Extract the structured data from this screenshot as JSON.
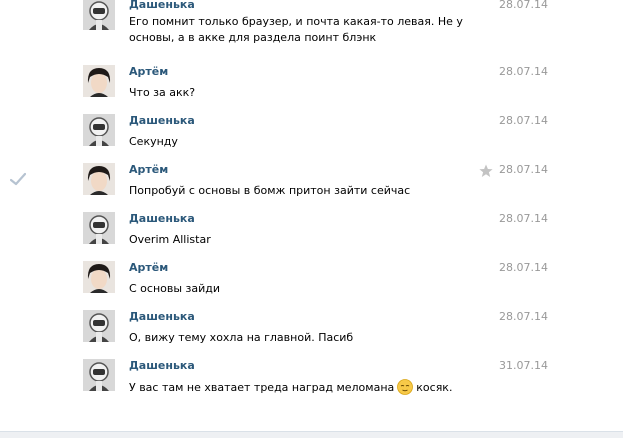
{
  "messages": [
    {
      "author": "Дашенька",
      "date": "28.07.14",
      "text": "Его помнит только браузер, и почта какая-то левая. Не у основы, а в акке для раздела поинт блэнк",
      "avatar": "helmet"
    },
    {
      "author": "Артём",
      "date": "28.07.14",
      "text": "Что за акк?",
      "avatar": "person"
    },
    {
      "author": "Дашенька",
      "date": "28.07.14",
      "text": "Секунду",
      "avatar": "helmet"
    },
    {
      "author": "Артём",
      "date": "28.07.14",
      "text": "Попробуй с основы в бомж притон зайти сейчас",
      "avatar": "person",
      "checked": true,
      "starred": true
    },
    {
      "author": "Дашенька",
      "date": "28.07.14",
      "text": "Overim Allistar",
      "avatar": "helmet"
    },
    {
      "author": "Артём",
      "date": "28.07.14",
      "text": "С основы зайди",
      "avatar": "person"
    },
    {
      "author": "Дашенька",
      "date": "28.07.14",
      "text": "О, вижу тему хохла на главной. Пасиб",
      "avatar": "helmet"
    },
    {
      "author": "Дашенька",
      "date": "31.07.14",
      "text_before": "У вас там не хватает треда наград меломана",
      "emoji": "relieved-face-emoji",
      "text_after": "косяк.",
      "avatar": "helmet"
    }
  ],
  "colors": {
    "author": "#2b587a",
    "date": "#999999",
    "check": "#b6c3d1",
    "star": "#c3c3c3"
  }
}
